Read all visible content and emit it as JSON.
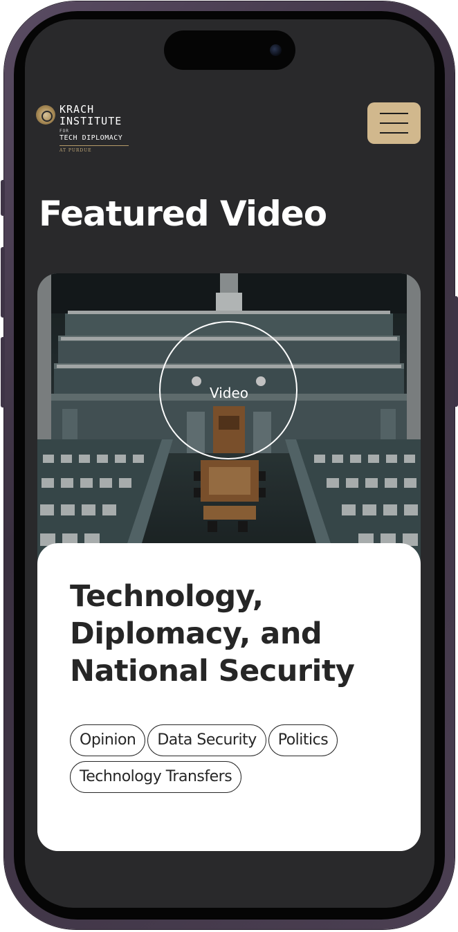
{
  "header": {
    "logo": {
      "line1": "KRACH",
      "line2": "INSTITUTE",
      "for": "FOR",
      "line3": "TECH DIPLOMACY",
      "sub": "AT PURDUE"
    },
    "menu_icon": "hamburger-icon",
    "menu_color": "#d1b88d"
  },
  "featured": {
    "title": "Featured Video",
    "video_label": "Video",
    "card_title": "Technology, Diplomacy, and National Security",
    "tags": [
      "Opinion",
      "Data Security",
      "Politics",
      "Technology Transfers"
    ]
  },
  "colors": {
    "background": "#29292b",
    "accent": "#d1b88d",
    "card": "#ffffff",
    "text_dark": "#262626"
  }
}
